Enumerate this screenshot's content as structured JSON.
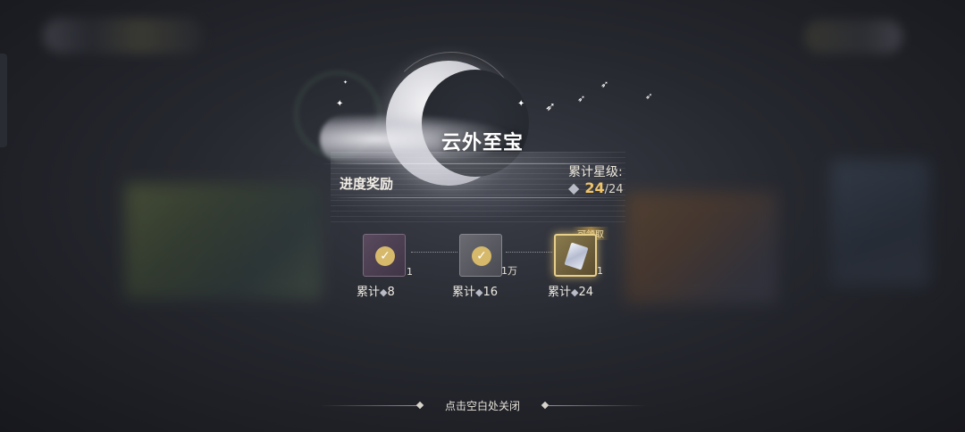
{
  "panel": {
    "title": "云外至宝",
    "section_title": "进度奖励",
    "stars_label": "累计星级:",
    "stars_icon": "diamond-star-icon",
    "stars_current": "24",
    "stars_total": "/24"
  },
  "rewards": [
    {
      "status": "claimed",
      "quantity": "1",
      "label_prefix": "累计",
      "requirement": "8",
      "icon": "check-icon"
    },
    {
      "status": "claimed",
      "quantity": "1万",
      "label_prefix": "累计",
      "requirement": "16",
      "icon": "check-icon"
    },
    {
      "status": "claimable",
      "quantity": "1",
      "label_prefix": "累计",
      "requirement": "24",
      "icon": "crystal-card-icon",
      "badge": "可领取"
    }
  ],
  "footer": {
    "close_hint": "点击空白处关闭"
  },
  "colors": {
    "accent_gold": "#f0c56a",
    "claimable_border": "#e8cf8a"
  }
}
